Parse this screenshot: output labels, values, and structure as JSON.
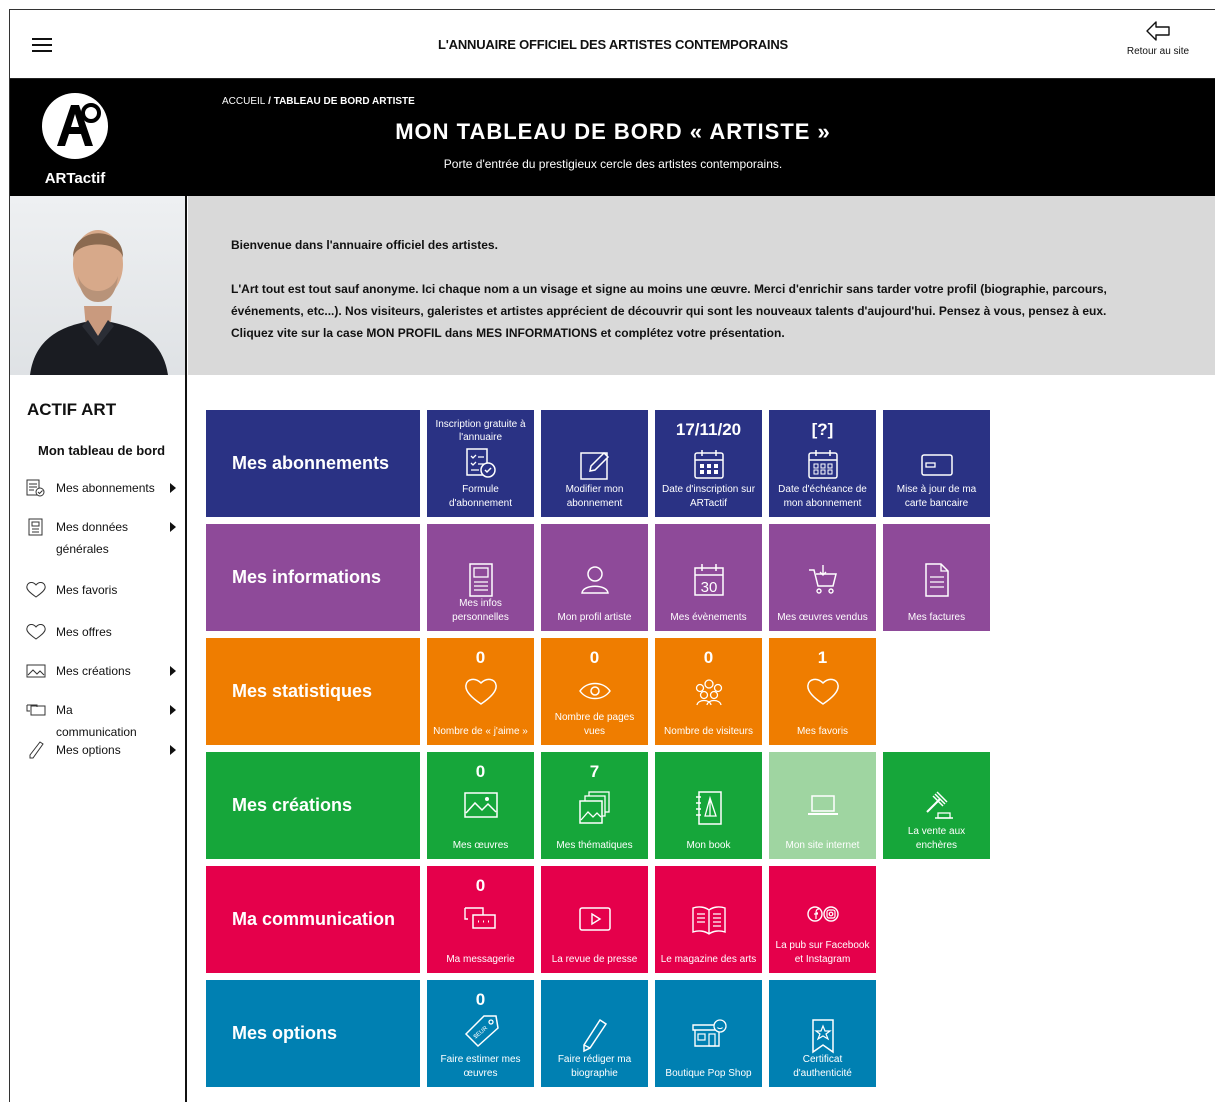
{
  "header": {
    "title": "L'ANNUAIRE OFFICIEL DES ARTISTES CONTEMPORAINS",
    "back_label": "Retour au site"
  },
  "hero": {
    "logo_text": "ARTactif",
    "crumb_home": "ACCUEIL",
    "crumb_sep": " / ",
    "crumb_current": "TABLEAU DE BORD ARTISTE",
    "title": "MON TABLEAU DE BORD « ARTISTE »",
    "subtitle": "Porte d'entrée du prestigieux cercle des artistes contemporains."
  },
  "welcome": {
    "line1": "Bienvenue dans l'annuaire officiel des artistes.",
    "line2": "L'Art tout est tout sauf anonyme. Ici chaque nom a un visage et signe au moins une œuvre. Merci d'enrichir sans tarder votre profil (biographie, parcours, événements, etc...). Nos visiteurs, galeristes et artistes apprécient de découvrir qui sont les nouveaux talents d'aujourd'hui. Pensez à vous, pensez à eux.",
    "line3": "Cliquez vite sur la case MON PROFIL dans MES INFORMATIONS et complétez votre présentation."
  },
  "sidebar": {
    "heading": "ACTIF ART",
    "sub": "Mon tableau de bord",
    "items": [
      {
        "label": "Mes abonnements",
        "icon": "subscription-icon"
      },
      {
        "label": "Mes données générales",
        "icon": "document-icon"
      },
      {
        "label": "Mes favoris",
        "icon": "heart-icon"
      },
      {
        "label": "Mes offres",
        "icon": "heart-icon"
      },
      {
        "label": "Mes créations",
        "icon": "image-icon"
      },
      {
        "label": "Ma communication",
        "icon": "chat-icon"
      },
      {
        "label": "Mes options",
        "icon": "pen-icon"
      }
    ]
  },
  "colors": {
    "navy": "#2a3284",
    "purple": "#8e4a99",
    "orange": "#ef7d00",
    "green": "#16a63a",
    "lightgreen": "#9fd5a1",
    "pink": "#e5004b",
    "blue": "#0080b2"
  },
  "rows": [
    {
      "label": "Mes abonnements",
      "color": "#2a3284",
      "tiles": [
        {
          "top": "Inscription gratuite à l'annuaire",
          "label": "Formule d'abonnement",
          "icon": "calendar-check-icon"
        },
        {
          "label": "Modifier mon abonnement",
          "icon": "edit-icon"
        },
        {
          "value": "17/11/20",
          "label": "Date d'inscription sur ARTactif",
          "icon": "calendar-icon"
        },
        {
          "value": "[?]",
          "label": "Date d'échéance de mon abonnement",
          "icon": "calendar-icon"
        },
        {
          "label": "Mise à jour de ma carte bancaire",
          "icon": "credit-card-icon"
        }
      ]
    },
    {
      "label": "Mes informations",
      "color": "#8e4a99",
      "tiles": [
        {
          "label": "Mes infos personnelles",
          "icon": "document-icon"
        },
        {
          "label": "Mon profil artiste",
          "icon": "user-icon"
        },
        {
          "label": "Mes évènements",
          "icon": "calendar-30-icon",
          "icon_text": "30"
        },
        {
          "label": "Mes œuvres vendus",
          "icon": "cart-icon"
        },
        {
          "label": "Mes factures",
          "icon": "invoice-icon"
        }
      ]
    },
    {
      "label": "Mes statistiques",
      "color": "#ef7d00",
      "tiles": [
        {
          "value": "0",
          "label": "Nombre de « j'aime »",
          "icon": "heart-icon"
        },
        {
          "value": "0",
          "label": "Nombre de pages vues",
          "icon": "eye-icon"
        },
        {
          "value": "0",
          "label": "Nombre de visiteurs",
          "icon": "group-icon"
        },
        {
          "value": "1",
          "label": "Mes favoris",
          "icon": "heart-icon"
        }
      ]
    },
    {
      "label": "Mes créations",
      "color": "#16a63a",
      "tiles": [
        {
          "value": "0",
          "label": "Mes œuvres",
          "icon": "image-icon"
        },
        {
          "value": "7",
          "label": "Mes thématiques",
          "icon": "images-stack-icon"
        },
        {
          "label": "Mon book",
          "icon": "book-icon"
        },
        {
          "label": "Mon site internet",
          "icon": "laptop-icon",
          "color": "#9fd5a1"
        },
        {
          "label": "La vente aux enchères",
          "icon": "gavel-icon"
        }
      ]
    },
    {
      "label": "Ma communication",
      "color": "#e5004b",
      "tiles": [
        {
          "value": "0",
          "label": "Ma messagerie",
          "icon": "chat-icon"
        },
        {
          "label": "La revue de presse",
          "icon": "video-icon"
        },
        {
          "label": "Le magazine des arts",
          "icon": "magazine-icon"
        },
        {
          "label": "La pub sur Facebook et Instagram",
          "icon": "social-icon"
        }
      ]
    },
    {
      "label": "Mes options",
      "color": "#0080b2",
      "tiles": [
        {
          "value": "0",
          "label": "Faire estimer mes œuvres",
          "icon": "price-tag-icon",
          "icon_text": "$EUR"
        },
        {
          "label": "Faire rédiger ma biographie",
          "icon": "pen-icon"
        },
        {
          "label": "Boutique Pop Shop",
          "icon": "shop-icon"
        },
        {
          "label": "Certificat d'authenticité",
          "icon": "certificate-icon"
        }
      ]
    }
  ]
}
